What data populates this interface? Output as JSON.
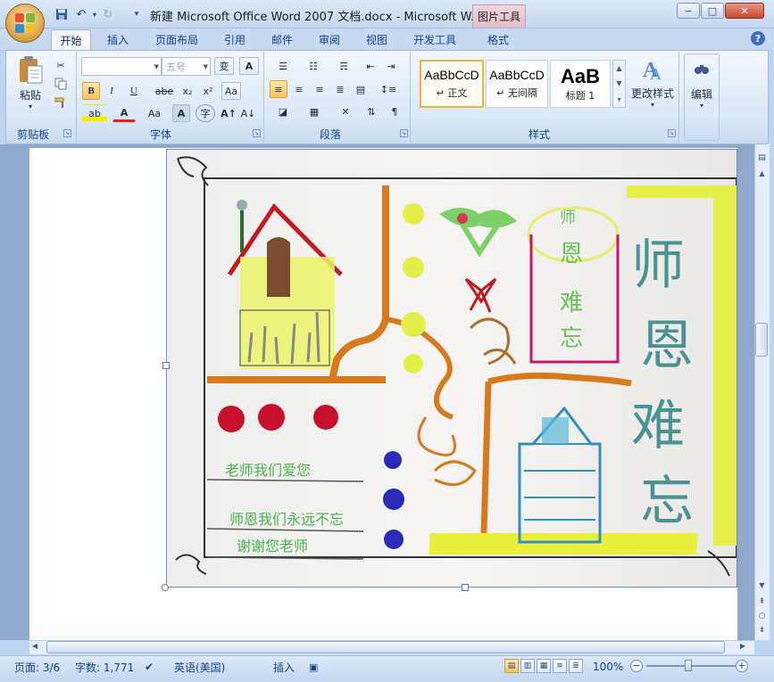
{
  "window": {
    "title": "新建 Microsoft Office Word 2007 文档.docx - Microsoft W...",
    "context_tab": "图片工具",
    "minimize": "−",
    "maximize": "□",
    "close": "✕"
  },
  "quick_access": {
    "save": "💾",
    "undo": "↶",
    "redo": "↻",
    "customize": "▾"
  },
  "tabs": [
    {
      "label": "开始"
    },
    {
      "label": "插入"
    },
    {
      "label": "页面布局"
    },
    {
      "label": "引用"
    },
    {
      "label": "邮件"
    },
    {
      "label": "审阅"
    },
    {
      "label": "视图"
    },
    {
      "label": "开发工具"
    },
    {
      "label": "格式"
    }
  ],
  "active_tab": "开始",
  "help": "?",
  "ribbon": {
    "clipboard": {
      "label": "剪贴板",
      "paste": "粘贴",
      "paste_arrow": "▾"
    },
    "font": {
      "label": "字体",
      "font_name": "",
      "font_size": "五号",
      "bold": "B",
      "italic": "I",
      "underline": "U",
      "strike": "abe",
      "subscript": "x₂",
      "superscript": "x²",
      "clear": "Aa",
      "highlight": "ab",
      "color": "A",
      "grow": "A↑",
      "shrink": "A↓",
      "change_case": "Aa",
      "char_border": "A",
      "enclose": "字",
      "wen": "变",
      "abc": "A"
    },
    "paragraph": {
      "label": "段落"
    },
    "styles": {
      "label": "样式",
      "items": [
        {
          "sample": "AaBbCcD",
          "name": "↵ 正文"
        },
        {
          "sample": "AaBbCcD",
          "name": "↵ 无间隔"
        },
        {
          "sample": "AaB",
          "name": "标题 1"
        }
      ],
      "change_styles": "更改样式",
      "change_arrow": "▾"
    },
    "editing": {
      "label": "编辑",
      "arrow": "▾"
    }
  },
  "drawing": {
    "title_chars": "师恩难忘",
    "small_chars": [
      "师",
      "恩",
      "难",
      "忘"
    ],
    "line1": "老师我们爱您",
    "line2": "师恩我们永远不忘",
    "line3": "谢谢您老师"
  },
  "status": {
    "page": "页面: 3/6",
    "words": "字数: 1,771",
    "language": "英语(美国)",
    "insert_mode": "插入",
    "zoom": "100%"
  }
}
